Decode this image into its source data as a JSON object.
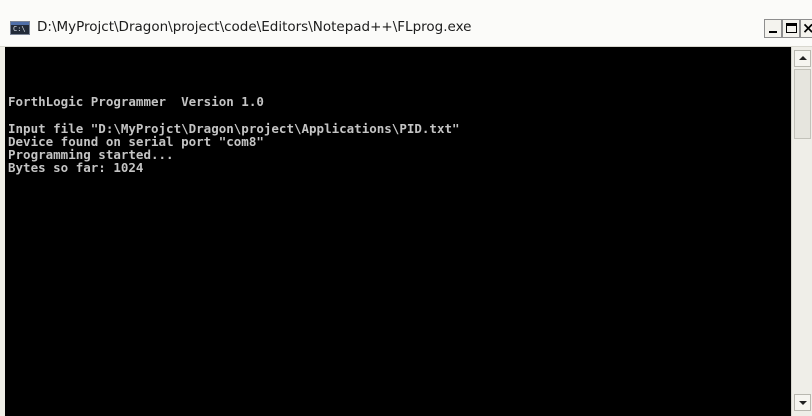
{
  "window": {
    "title": "D:\\MyProjct\\Dragon\\project\\code\\Editors\\Notepad++\\FLprog.exe",
    "app_icon": "console-app-icon",
    "icon_prompt": "C:\\",
    "controls": {
      "minimize": "minimize-icon",
      "maximize": "maximize-icon",
      "close": "close-icon",
      "close_glyph": "×"
    }
  },
  "console": {
    "background": "#000000",
    "text_color": "#c4c4c4",
    "lines": [
      "ForthLogic Programmer  Version 1.0",
      "Input file \"D:\\MyProjct\\Dragon\\project\\Applications\\PID.txt\"",
      "Device found on serial port \"com8\"",
      "Programming started...",
      "Bytes so far: 1024"
    ]
  },
  "scrollbar": {
    "up_icon": "scroll-up-arrow-icon",
    "down_icon": "scroll-down-arrow-icon"
  }
}
